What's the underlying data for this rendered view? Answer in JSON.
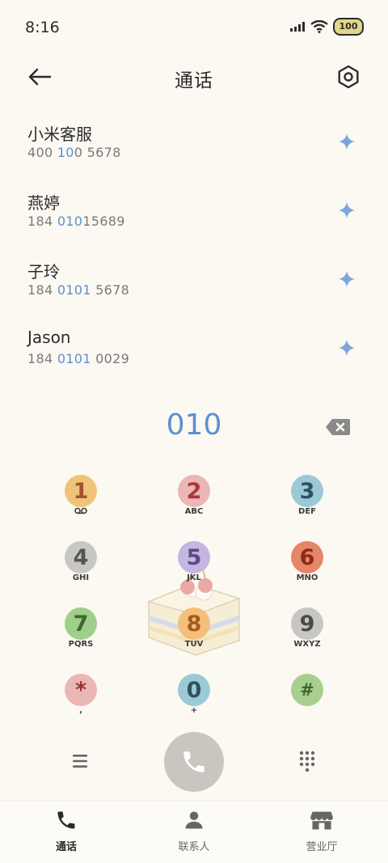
{
  "status_bar": {
    "time": "8:16",
    "battery": "100"
  },
  "header": {
    "title": "通话"
  },
  "contacts": [
    {
      "name": "小米客服",
      "number_parts": [
        "400 ",
        "10",
        "0 5678"
      ]
    },
    {
      "name": "燕婷",
      "number_parts": [
        "184 ",
        "010",
        "15689"
      ]
    },
    {
      "name": "子玲",
      "number_parts": [
        "184 ",
        "0101",
        " 5678"
      ]
    },
    {
      "name": "Jason",
      "number_parts": [
        "184 ",
        "0101",
        " 0029"
      ]
    }
  ],
  "dialer": {
    "entered_number": "010"
  },
  "keypad": {
    "keys": [
      {
        "digit": "1",
        "letters": "",
        "color": "#f0c37a",
        "text_color": "#a0522d"
      },
      {
        "digit": "2",
        "letters": "ABC",
        "color": "#eab7b5",
        "text_color": "#b0343e"
      },
      {
        "digit": "3",
        "letters": "DEF",
        "color": "#9cc9d6",
        "text_color": "#2b5363"
      },
      {
        "digit": "4",
        "letters": "GHI",
        "color": "#c8c7c2",
        "text_color": "#555555"
      },
      {
        "digit": "5",
        "letters": "JKL",
        "color": "#c4b6e0",
        "text_color": "#5a4a86"
      },
      {
        "digit": "6",
        "letters": "MNO",
        "color": "#e48667",
        "text_color": "#8a2a14"
      },
      {
        "digit": "7",
        "letters": "PQRS",
        "color": "#9fcf8a",
        "text_color": "#3e6a2c"
      },
      {
        "digit": "8",
        "letters": "TUV",
        "color": "#f2c07b",
        "text_color": "#a75a1e"
      },
      {
        "digit": "9",
        "letters": "WXYZ",
        "color": "#c7c6c1",
        "text_color": "#4a4a4a"
      },
      {
        "digit": "*",
        "letters": ",",
        "color": "#eab7b5",
        "text_color": "#9c2f3a"
      },
      {
        "digit": "0",
        "letters": "+",
        "color": "#9cc9d6",
        "text_color": "#2b5363"
      },
      {
        "digit": "#",
        "letters": "",
        "color": "#a8cf8e",
        "text_color": "#3e6a2c"
      }
    ]
  },
  "bottom_nav": {
    "calls": "通话",
    "contacts": "联系人",
    "business_hall": "营业厅"
  },
  "colors": {
    "background": "#fcf9f2",
    "accent": "#5d8fd1",
    "call_button": "#c8c6be"
  }
}
